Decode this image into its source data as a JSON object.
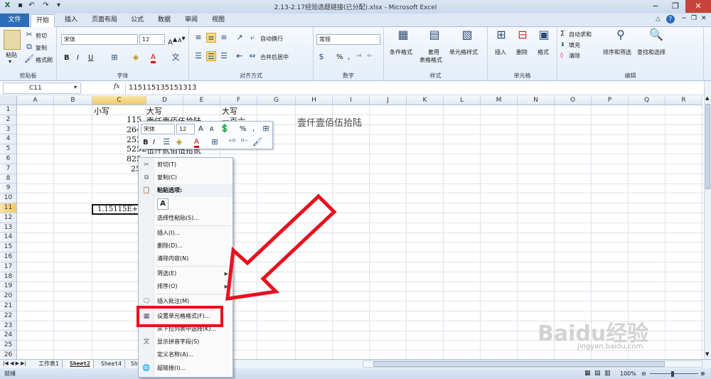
{
  "window": {
    "title": "2.13-2.17经验选题链接(已分配).xlsx - Microsoft Excel",
    "min": "−",
    "restore": "❐",
    "close": "✕"
  },
  "tabs": {
    "file": "文件",
    "home": "开始",
    "insert": "插入",
    "layout": "页面布局",
    "formulas": "公式",
    "data": "数据",
    "review": "审阅",
    "view": "视图"
  },
  "ribbon": {
    "clipboard": {
      "paste": "粘贴",
      "cut": "剪切",
      "copy": "复制",
      "painter": "格式刷",
      "label": "剪贴板"
    },
    "font": {
      "name": "宋体",
      "size": "12",
      "label": "字体",
      "bold": "B",
      "italic": "I",
      "underline": "U",
      "color_a": "A"
    },
    "align": {
      "wrap": "自动换行",
      "merge": "合并后居中",
      "label": "对齐方式"
    },
    "number": {
      "format": "常规",
      "percent": "%",
      "comma": ",",
      "label": "数字"
    },
    "styles": {
      "cond": "条件格式",
      "table1": "套用",
      "table2": "表格格式",
      "cellstyle": "单元格样式",
      "label": "样式"
    },
    "cells": {
      "insert": "插入",
      "delete": "删除",
      "format": "格式",
      "label": "单元格"
    },
    "edit": {
      "autosum": "自动求和",
      "fill": "填充",
      "clear": "清除",
      "sort": "排序和筛选",
      "find": "查找和选择",
      "label": "编辑"
    }
  },
  "formula": {
    "namebox": "C11",
    "fx": "fx",
    "value": "115115135151313"
  },
  "columns": [
    "A",
    "B",
    "C",
    "D",
    "E",
    "F",
    "G",
    "H",
    "I",
    "J",
    "K",
    "L",
    "M",
    "N",
    "O",
    "P",
    "Q",
    "R"
  ],
  "rows": [
    "1",
    "2",
    "3",
    "4",
    "5",
    "6",
    "7",
    "8",
    "9",
    "10",
    "11",
    "12",
    "13",
    "14",
    "15",
    "16",
    "17",
    "18",
    "19",
    "20",
    "21",
    "22",
    "23",
    "24",
    "25",
    "26",
    "27"
  ],
  "cells": {
    "c1": "小写",
    "d1": "大写",
    "f1": "大写",
    "c2": "115",
    "d2": "壹仟壹佰伍拾陆",
    "f2": "一百六",
    "c3": "264",
    "c4": "252",
    "c5": "5252",
    "d5": "伍仟贰佰伍拾贰",
    "c6": "825",
    "c7": "25",
    "h2": "壹仟壹佰伍拾陆",
    "c11": "1.15115E+1"
  },
  "minitoolbar": {
    "font": "宋体",
    "size": "12",
    "grow": "A",
    "shrink": "A",
    "percent": "%",
    "comma": ",",
    "bold": "B",
    "italic": "I",
    "color": "A"
  },
  "contextmenu": {
    "cut": "剪切(T)",
    "copy": "复制(C)",
    "paste_opts": "粘贴选项:",
    "paste_a": "A",
    "special": "选择性粘贴(S)...",
    "insert": "插入(I)...",
    "delete": "删除(D)...",
    "clear": "清除内容(N)",
    "filter": "筛选(E)",
    "sort": "排序(O)",
    "comment": "插入批注(M)",
    "format": "设置单元格格式(F)...",
    "dropdown": "从下拉列表中选择(K)...",
    "phonetic": "显示拼音字段(S)",
    "define": "定义名称(A)...",
    "link": "超链接(I)..."
  },
  "sheets": [
    "工作表1",
    "Sheet2",
    "Sheet4",
    "Sh"
  ],
  "status": {
    "mode": "就绪",
    "zoom": "100%"
  },
  "watermark": "Baidu经验",
  "watermark_url": "jingyan.baidu.com",
  "colors": {
    "accent": "#2c6db7",
    "highlight": "#e8101e"
  }
}
